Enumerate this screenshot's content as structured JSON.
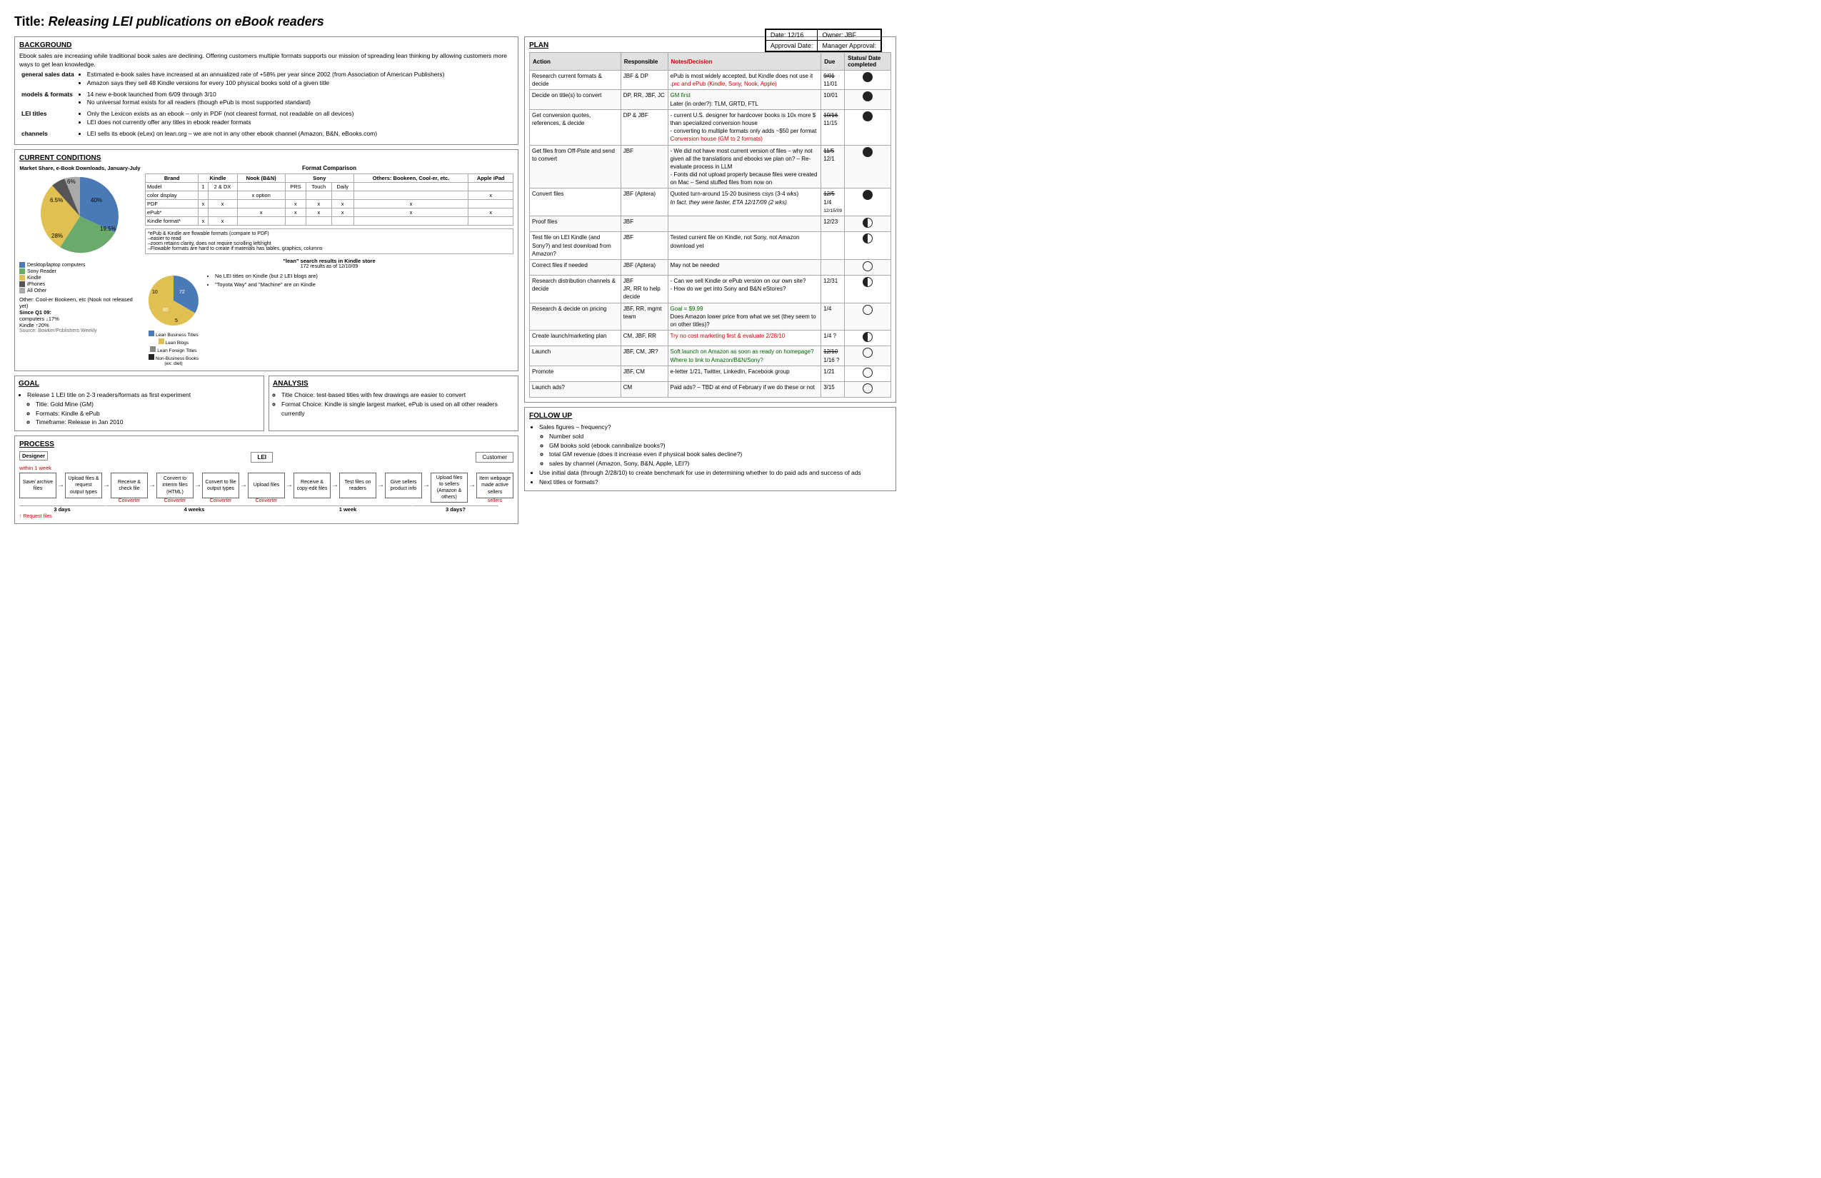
{
  "title": {
    "prefix": "Title: ",
    "italic": "Releasing LEI publications on eBook readers"
  },
  "meta": {
    "date_label": "Date: 12/16",
    "owner_label": "Owner: JBF",
    "approval_label": "Approval Date:",
    "manager_label": "Manager Approval:"
  },
  "background": {
    "title": "BACKGROUND",
    "intro": "Ebook sales are increasing while traditional book sales are declining. Offering customers multiple formats supports our mission of spreading lean thinking by allowing customers more ways to get lean knowledge.",
    "rows": [
      {
        "label": "general sales data",
        "items": [
          "Estimated e-book sales have increased at an annualized rate of +58% per year since 2002 (from Association of American Publishers)",
          "Amazon says they sell 48 Kindle versions for every 100 physical books sold of a given title"
        ]
      },
      {
        "label": "models & formats",
        "items": [
          "14 new e-book launched from 6/09 through 3/10",
          "No universal format exists for all readers (though ePub is most supported standard)"
        ]
      },
      {
        "label": "LEI titles",
        "items": [
          "Only the Lexicon exists as an ebook – only in PDF (not clearest format, not readable on all devices)",
          "LEI does not currently offer any titles in ebook reader formats"
        ]
      },
      {
        "label": "channels",
        "items": [
          "LEI sells its ebook (eLex) on lean.org – we are not in any other ebook channel (Amazon, B&N, eBooks.com)"
        ]
      }
    ]
  },
  "current_conditions": {
    "title": "CURRENT CONDITIONS",
    "pie_title": "Market Share, e-Book Downloads, January-July",
    "pie_segments": [
      {
        "label": "Desktop/laptop computers",
        "color": "#4a7ab5",
        "value": 40,
        "pct": "40%"
      },
      {
        "label": "Sony Reader",
        "color": "#6aaa6a",
        "value": 19.5,
        "pct": "19.5%"
      },
      {
        "label": "Kindle",
        "color": "#e0c050",
        "value": 28,
        "pct": "28%"
      },
      {
        "label": "iPhones",
        "color": "#555",
        "value": 6.5,
        "pct": "6.5%"
      },
      {
        "label": "All Other",
        "color": "#aaa",
        "value": 6,
        "pct": "6%"
      }
    ],
    "format_title": "Format Comparison",
    "format_headers": [
      "Brand",
      "Kindle",
      "Nook",
      "Sony",
      "Others: Bookeen, Cool-er, etc.",
      "Apple iPad"
    ],
    "format_subheaders": [
      "Model",
      "1",
      "2 & DX",
      "(B&N)",
      "PRS",
      "Touch",
      "Daily",
      ""
    ],
    "format_rows": [
      {
        "name": "color display",
        "values": [
          "",
          "",
          "x option",
          "",
          "",
          "",
          "",
          "x"
        ]
      },
      {
        "name": "PDF",
        "values": [
          "x",
          "x",
          "",
          "x",
          "x",
          "x",
          "x",
          ""
        ]
      },
      {
        "name": "ePub*",
        "values": [
          "",
          "",
          "x",
          "x",
          "x",
          "x",
          "x",
          "x"
        ]
      },
      {
        "name": "Kindle format*",
        "values": [
          "x",
          "x",
          "",
          "",
          "",
          "",
          "",
          ""
        ]
      }
    ],
    "format_note": "*ePub & Kindle are flowable formats (compare to PDF)\n–easier to read\n–zoom retains clarity, does not require scrolling left/right\n–Flowable formats are hard to create if materials has tables, graphics, columns",
    "kindle_search_title": "\"lean\" search results in Kindle store",
    "kindle_search_subtitle": "172 results as of 12/10/09",
    "kindle_legend": [
      {
        "label": "Lean Business Titles",
        "color": "#4a7ab5"
      },
      {
        "label": "Lean Blogs",
        "color": "#e0c050"
      },
      {
        "label": "Lean Foreign Titles",
        "color": "#888"
      },
      {
        "label": "Non-Business Books (ex: diet)",
        "color": "#222"
      }
    ],
    "kindle_bullets": [
      "No LEI titles on Kindle (but 2 LEI blogs are)",
      "\"Toyota Way\" and \"Machine\" are on Kindle"
    ],
    "since_q1": "Since Q1 09:",
    "computers_label": "computers",
    "computers_val": "↓17%",
    "kindle_label": "Kindle",
    "kindle_val": "↑20%",
    "source": "Source: Bowker/Publishers Weekly",
    "other_label": "Other: Cool-er Bookeen, etc (Nook not released yet)"
  },
  "goal": {
    "title": "GOAL",
    "items": [
      "Release 1 LEI title on 2-3 readers/formats as first experiment",
      "Title: Gold Mine (GM)",
      "Formats: Kindle & ePub",
      "Timeframe: Release in Jan 2010"
    ]
  },
  "analysis": {
    "title": "ANALYSIS",
    "items": [
      "Title Choice: test-based titles with few drawings are easier to convert",
      "Format Choice: Kindle is single largest market, ePub is used on all other readers currently"
    ]
  },
  "process": {
    "title": "PROCESS",
    "designer_label": "Designer",
    "lei_label": "LEI",
    "customer_label": "Customer",
    "within_week": "within 1 week",
    "steps": [
      {
        "label": "Save/ archive files",
        "sub": ""
      },
      {
        "label": "Upload files & request output types",
        "sub": ""
      },
      {
        "label": "Receive & check file",
        "sub": "Converter"
      },
      {
        "label": "Convert to interim files (HTML)",
        "sub": "Converter"
      },
      {
        "label": "Convert to file output types",
        "sub": "Converter"
      },
      {
        "label": "Upload files",
        "sub": "Converter"
      },
      {
        "label": "Receive & copy-edit files",
        "sub": ""
      },
      {
        "label": "Test files on readers",
        "sub": ""
      },
      {
        "label": "Give sellers product info",
        "sub": ""
      },
      {
        "label": "Upload files to sellers (Amazon & others)",
        "sub": ""
      },
      {
        "label": "Item webpage made active sellers",
        "sub": "sellers"
      }
    ],
    "durations": [
      {
        "label": "3 days",
        "span": 2
      },
      {
        "label": "4 weeks",
        "span": 4
      },
      {
        "label": "1 week",
        "span": 3
      },
      {
        "label": "3 days?",
        "span": 2
      }
    ]
  },
  "plan": {
    "title": "PLAN",
    "headers": [
      "Action",
      "Responsible",
      "Notes/Decision",
      "Due",
      "Status/ Date completed"
    ],
    "rows": [
      {
        "action": "Research current formats & decide",
        "responsible": "JBF & DP",
        "notes": "ePub is most widely accepted, but Kindle does not use it\n.prc and ePub (Kindle, Sony, Nook, Apple)",
        "notes_color": "red",
        "due": "9/01\n11/01",
        "status": "filled"
      },
      {
        "action": "Decide on title(s) to convert",
        "responsible": "DP, RR, JBF, JC",
        "notes": "GM first\nLater (in order?): TLM, GRTD, FTL",
        "notes_color": "green",
        "due": "10/01",
        "status": "filled"
      },
      {
        "action": "Get conversion quotes, references, & decide",
        "responsible": "DP & JBF",
        "notes": "- current U.S. designer for hardcover books is 10x more $ than specialized conversion house\n- converting to multiple formats only adds ~$50 per format\nConversion house (GM to 2 formats)",
        "notes_color": "red",
        "due": "10/16\n11/15",
        "status": "filled"
      },
      {
        "action": "Get files from Off-Piste and send to convert",
        "responsible": "JBF",
        "notes": "- We did not have most current version of files – why not given all the translations and ebooks we plan on? – Re-evaluate process in LLM\n- Fonts did not upload properly because files were created on Mac – Send stuffed files from now on",
        "notes_color": "normal",
        "due": "11/5\n12/1",
        "status": "filled"
      },
      {
        "action": "Convert files",
        "responsible": "JBF (Aptera)",
        "notes": "Quoted turn-around 15-20 business csys (3-4 wks)\nIn fact, they were faster, ETA 12/17/09 (2 wks)",
        "notes_color": "normal",
        "due": "12/5\n1/4",
        "status": "filled",
        "due2": "12/15/09"
      },
      {
        "action": "Proof files",
        "responsible": "JBF",
        "notes": "",
        "notes_color": "normal",
        "due": "12/23",
        "status": "half"
      },
      {
        "action": "Test file on LEI Kindle (and Sony?) and test download from Amazon?",
        "responsible": "JBF",
        "notes": "Tested current file on Kindle, not Sony, not Amazon download yet",
        "notes_color": "normal",
        "due": "",
        "status": "half"
      },
      {
        "action": "Correct files if needed",
        "responsible": "JBF (Aptera)",
        "notes": "May not be needed",
        "notes_color": "normal",
        "due": "",
        "status": "empty"
      },
      {
        "action": "Research distribution channels & decide",
        "responsible": "JBF\nJR, RR to help decide",
        "notes": "- Can we sell Kindle or ePub version on our own site?\n- How do we get into Sony and B&N eStores?",
        "notes_color": "normal",
        "due": "12/31",
        "status": "half"
      },
      {
        "action": "Research & decide on pricing",
        "responsible": "JBF, RR, mgmt team",
        "notes": "Goal = $9.99\nDoes Amazon lower price from what we set (they seem to on other titles)?",
        "notes_color": "green",
        "due": "1/4",
        "status": "empty"
      },
      {
        "action": "Create launch/marketing plan",
        "responsible": "CM, JBF, RR",
        "notes": "Try no cost marketing first & evaluate 2/28/10",
        "notes_color": "red",
        "due": "1/4 ?",
        "status": "half"
      },
      {
        "action": "Launch",
        "responsible": "JBF, CM, JR?",
        "notes": "Soft launch on Amazon as soon as ready on homepage? Where to link to Amazon/B&N/Sony?",
        "notes_color": "green",
        "due": "12/10\n1/16 ?",
        "status": "empty"
      },
      {
        "action": "Promote",
        "responsible": "JBF, CM",
        "notes": "e-letter 1/21, Twitter, LinkedIn, Facebook group",
        "notes_color": "normal",
        "due": "1/21",
        "status": "empty"
      },
      {
        "action": "Launch ads?",
        "responsible": "CM",
        "notes": "Paid ads? – TBD at end of February if we do these or not",
        "notes_color": "normal",
        "due": "3/15",
        "status": "empty"
      }
    ]
  },
  "follow_up": {
    "title": "FOLLOW UP",
    "items": [
      {
        "text": "Sales figures – frequency?",
        "sub": [
          "Number sold",
          "GM books sold (ebook cannibalize books?)",
          "total GM revenue (does it increase even if physical book sales decline?)",
          "sales by channel (Amazon, Sony, B&N, Apple, LEI?)"
        ]
      },
      {
        "text": "Use initial data (through 2/28/10) to create benchmark for use in determining whether to do paid ads and success of ads",
        "sub": []
      },
      {
        "text": "Next titles or formats?",
        "sub": []
      }
    ]
  }
}
